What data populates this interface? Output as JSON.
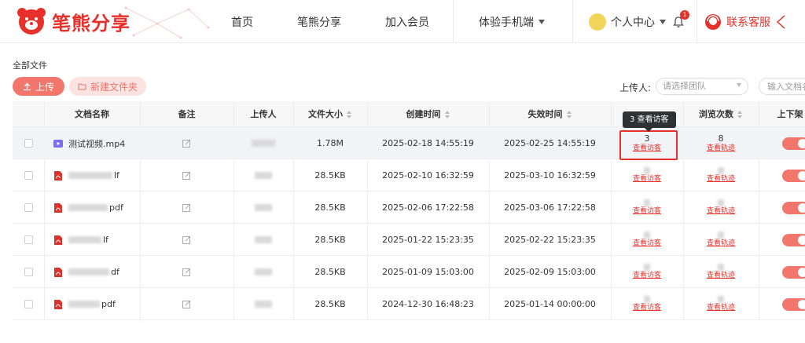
{
  "header": {
    "logo_text": "笔熊分享",
    "logo_icon": "bear-icon",
    "nav": [
      {
        "label": "首页"
      },
      {
        "label": "笔熊分享"
      },
      {
        "label": "加入会员"
      },
      {
        "label": "体验手机端"
      }
    ],
    "user_center": "个人中心",
    "notification_count": "1",
    "customer_service": "联系客服"
  },
  "toolbar": {
    "breadcrumb": "全部文件",
    "upload_label": "上传",
    "new_folder_label": "新建文件夹",
    "uploader_label": "上传人:",
    "team_placeholder": "请选择团队",
    "search_placeholder": "输入文档名"
  },
  "table": {
    "columns": [
      "文档名称",
      "备注",
      "上传人",
      "文件大小",
      "创建时间",
      "失效时间",
      "",
      "浏览次数",
      "上下架"
    ],
    "rows": [
      {
        "type": "video",
        "name": "测试视频.mp4",
        "size": "1.78M",
        "created": "2025-02-18 14:55:19",
        "expires": "2025-02-25 14:55:19",
        "visitors": "3",
        "views": "8"
      },
      {
        "type": "pdf",
        "name": "lf",
        "size": "28.5KB",
        "created": "2025-02-10 16:32:59",
        "expires": "2025-03-10 16:32:59",
        "visitors": "",
        "views": ""
      },
      {
        "type": "pdf",
        "name": "pdf",
        "size": "28.5KB",
        "created": "2025-02-06 17:22:58",
        "expires": "2025-03-06 17:22:58",
        "visitors": "",
        "views": ""
      },
      {
        "type": "pdf",
        "name": "lf",
        "size": "28.5KB",
        "created": "2025-01-22 15:23:35",
        "expires": "2025-02-22 15:23:35",
        "visitors": "",
        "views": ""
      },
      {
        "type": "pdf",
        "name": "df",
        "size": "28.5KB",
        "created": "2025-01-09 15:03:00",
        "expires": "2025-02-09 15:03:00",
        "visitors": "",
        "views": ""
      },
      {
        "type": "pdf",
        "name": "pdf",
        "size": "28.5KB",
        "created": "2024-12-30 16:48:23",
        "expires": "2025-01-14 00:00:00",
        "visitors": "",
        "views": ""
      }
    ],
    "view_visitors": "查看访客",
    "view_trace": "查看轨迹",
    "tooltip": "3 查看访客"
  },
  "colors": {
    "brand_red": "#e8302a",
    "accent_salmon": "#f2766b",
    "pdf_red": "#d9342b",
    "video_purple": "#7b6cf0"
  }
}
